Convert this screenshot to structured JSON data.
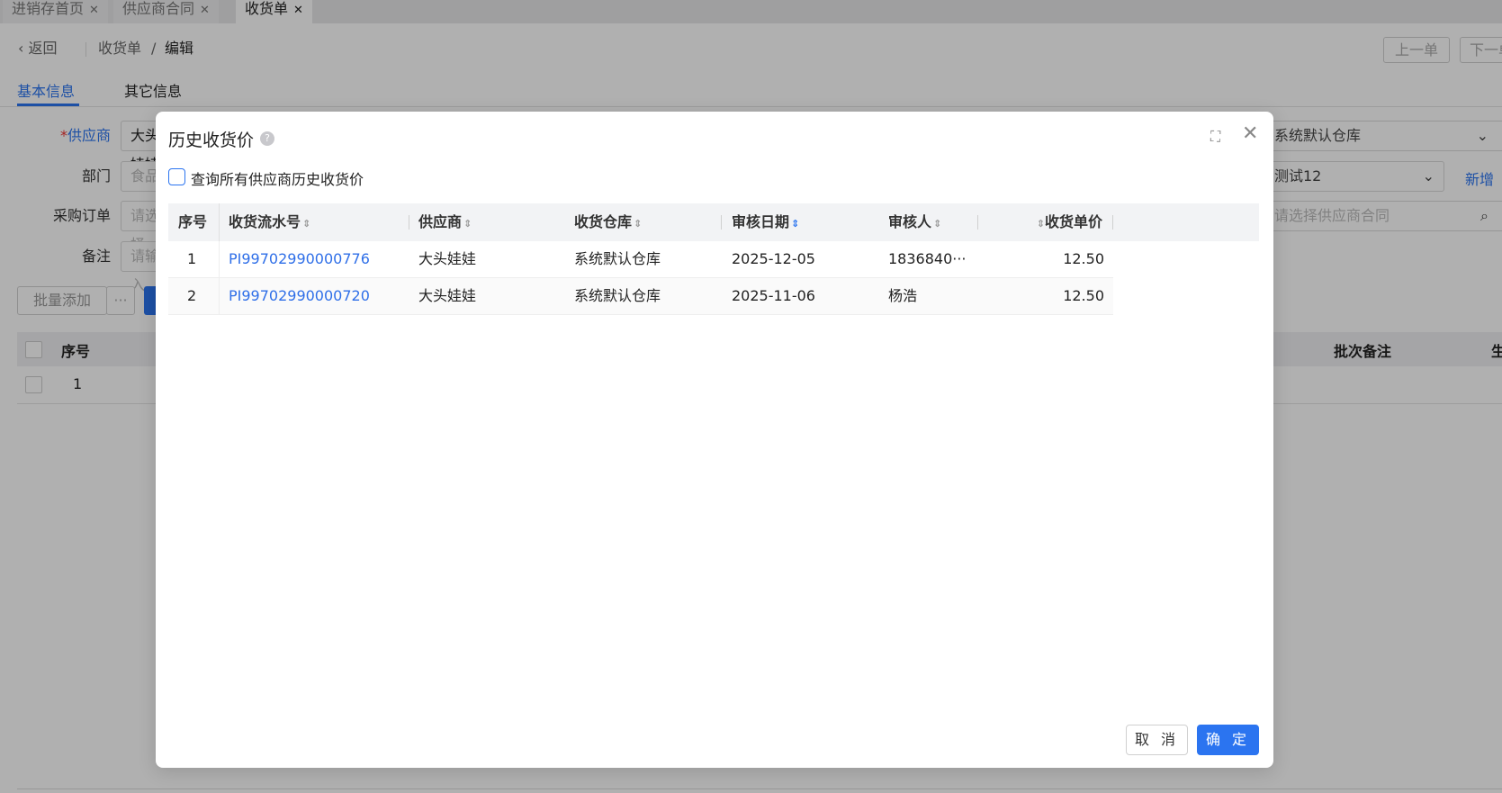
{
  "page_tabs": [
    {
      "label": "进销存首页"
    },
    {
      "label": "供应商合同"
    },
    {
      "label": "收货单"
    }
  ],
  "breadcrumb": {
    "back": "返回",
    "parent": "收货单",
    "current": "编辑"
  },
  "nav_buttons": {
    "prev": "上一单",
    "next": "下一单"
  },
  "form_tabs": [
    {
      "label": "基本信息"
    },
    {
      "label": "其它信息"
    }
  ],
  "form": {
    "supplier": {
      "label": "供应商",
      "value": "大头娃娃"
    },
    "department": {
      "label": "部门",
      "value": "食品"
    },
    "purchase_order": {
      "label": "采购订单",
      "placeholder": "请选择"
    },
    "remark": {
      "label": "备注",
      "placeholder": "请输入"
    },
    "warehouse": {
      "value": "系统默认仓库"
    },
    "handler": {
      "value": "测试12",
      "add": "新增"
    },
    "contract": {
      "placeholder": "请选择供应商合同"
    }
  },
  "toolbar": {
    "batch_add": "批量添加",
    "more": "···"
  },
  "grid": {
    "headers": {
      "index": "序号",
      "batch_remark": "批次备注",
      "produce": "生"
    },
    "rows": [
      {
        "index": "1"
      }
    ]
  },
  "modal": {
    "title": "历史收货价",
    "checkbox_label": "查询所有供应商历史收货价",
    "columns": [
      "序号",
      "收货流水号",
      "供应商",
      "收货仓库",
      "审核日期",
      "审核人",
      "收货单价"
    ],
    "rows": [
      {
        "index": "1",
        "serial": "PI99702990000776",
        "supplier": "大头娃娃",
        "warehouse": "系统默认仓库",
        "date": "2025-12-05",
        "reviewer": "1836840···",
        "price": "12.50"
      },
      {
        "index": "2",
        "serial": "PI99702990000720",
        "supplier": "大头娃娃",
        "warehouse": "系统默认仓库",
        "date": "2025-11-06",
        "reviewer": "杨浩",
        "price": "12.50"
      }
    ],
    "cancel": "取 消",
    "confirm": "确 定"
  },
  "colors": {
    "primary": "#2b74f0",
    "link": "#2f6fe8",
    "required": "#e33"
  }
}
